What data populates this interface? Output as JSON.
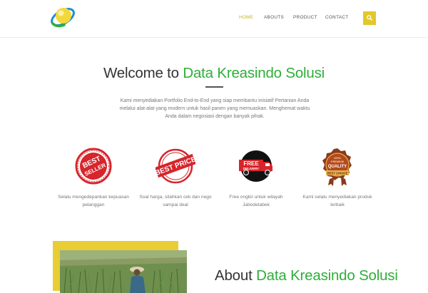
{
  "header": {
    "nav": [
      {
        "label": "HOME",
        "active": true
      },
      {
        "label": "ABOUTS",
        "active": false
      },
      {
        "label": "PRODUCT",
        "active": false
      },
      {
        "label": "CONTACT",
        "active": false
      }
    ],
    "search_icon": "search-icon",
    "colors": {
      "accent": "#e3c82a",
      "active_nav": "#c9b21a"
    }
  },
  "welcome": {
    "title_prefix": "Welcome to",
    "title_accent": "Data Kreasindo Solusi",
    "intro": "Kami menyediakan Portfolio End-to-End yang siap membantu inisiatif Pertanian Anda melalui alat-alat yang modern untuk hasil panen yang memuaskan. Menghemat waktu Anda dalam negosiasi dengan banyak pihak.",
    "accent_color": "#2fae3a"
  },
  "features": [
    {
      "icon": "best-seller-stamp-icon",
      "badge_text": [
        "BEST",
        "SELLER"
      ],
      "caption": "Selalu mengedepankan kepuasan pelanggan"
    },
    {
      "icon": "best-price-stamp-icon",
      "badge_text": [
        "BEST PRICE"
      ],
      "caption": "Soal harga, silahkan cek dan nego sampai deal"
    },
    {
      "icon": "free-delivery-truck-icon",
      "badge_text": [
        "FREE",
        "DELIVERY"
      ],
      "caption": "Free ongkir untuk wilayah Jabodetabek"
    },
    {
      "icon": "premium-quality-badge-icon",
      "badge_text": [
        "100%",
        "PREMIUM",
        "QUALITY",
        "BEST CHOICE"
      ],
      "caption": "Kami selalu menyediakan produk terbaik"
    }
  ],
  "about": {
    "title_prefix": "About",
    "title_accent": "Data Kreasindo Solusi"
  }
}
